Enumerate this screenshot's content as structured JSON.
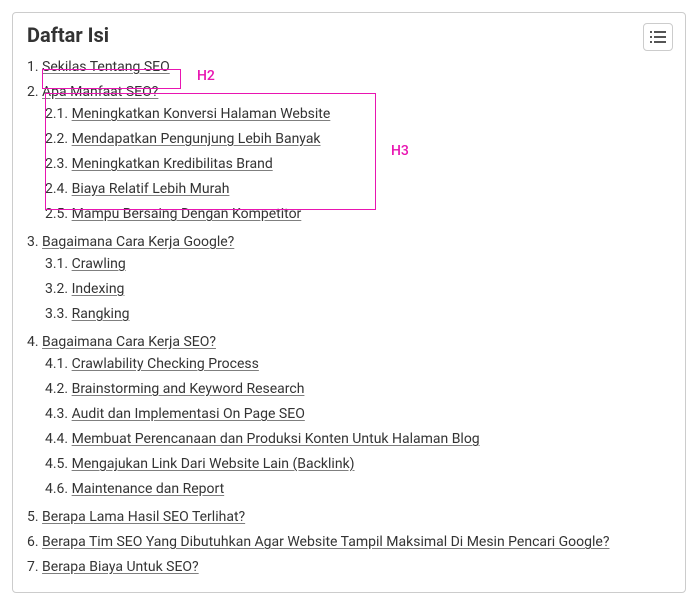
{
  "title": "Daftar Isi",
  "annotations": {
    "h2": "H2",
    "h3": "H3"
  },
  "items": [
    {
      "num": "1.",
      "label": "Sekilas Tentang SEO"
    },
    {
      "num": "2.",
      "label": "Apa Manfaat SEO?",
      "children": [
        {
          "num": "2.1.",
          "label": "Meningkatkan Konversi Halaman Website"
        },
        {
          "num": "2.2.",
          "label": "Mendapatkan Pengunjung Lebih Banyak"
        },
        {
          "num": "2.3.",
          "label": "Meningkatkan Kredibilitas Brand"
        },
        {
          "num": "2.4.",
          "label": "Biaya Relatif Lebih Murah"
        },
        {
          "num": "2.5.",
          "label": "Mampu Bersaing Dengan Kompetitor"
        }
      ]
    },
    {
      "num": "3.",
      "label": "Bagaimana Cara Kerja Google?",
      "children": [
        {
          "num": "3.1.",
          "label": "Crawling"
        },
        {
          "num": "3.2.",
          "label": "Indexing"
        },
        {
          "num": "3.3.",
          "label": "Rangking"
        }
      ]
    },
    {
      "num": "4.",
      "label": "Bagaimana Cara Kerja SEO?",
      "children": [
        {
          "num": "4.1.",
          "label": "Crawlability Checking Process"
        },
        {
          "num": "4.2.",
          "label": "Brainstorming and Keyword Research"
        },
        {
          "num": "4.3.",
          "label": "Audit dan Implementasi On Page SEO"
        },
        {
          "num": "4.4.",
          "label": "Membuat Perencanaan dan Produksi Konten Untuk Halaman Blog"
        },
        {
          "num": "4.5.",
          "label": "Mengajukan Link Dari Website Lain (Backlink)"
        },
        {
          "num": "4.6.",
          "label": "Maintenance dan Report"
        }
      ]
    },
    {
      "num": "5.",
      "label": "Berapa Lama Hasil SEO Terlihat?"
    },
    {
      "num": "6.",
      "label": "Berapa Tim SEO Yang Dibutuhkan Agar Website Tampil Maksimal Di Mesin Pencari Google?"
    },
    {
      "num": "7.",
      "label": "Berapa Biaya Untuk SEO?"
    }
  ]
}
